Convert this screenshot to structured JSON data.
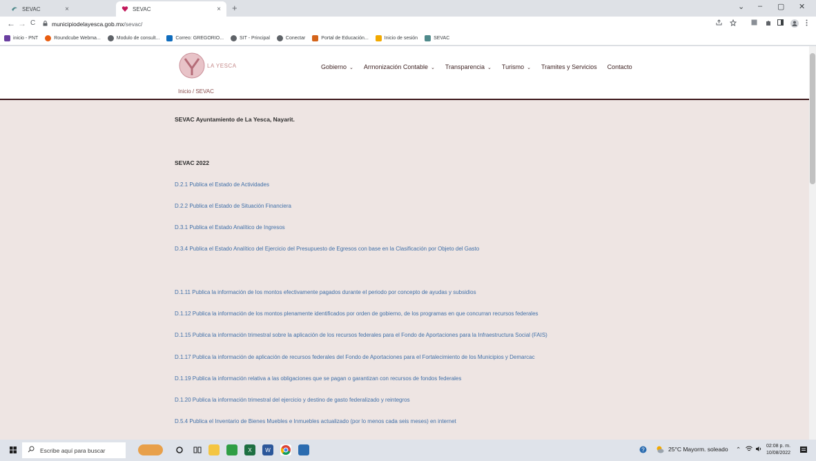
{
  "browser": {
    "tabs": [
      {
        "title": "SEVAC"
      },
      {
        "title": "SEVAC"
      }
    ],
    "new_tab": "+",
    "close_glyph": "×",
    "window_controls": {
      "collapse": "⌄",
      "minimize": "–",
      "restore": "▢",
      "close": "✕"
    },
    "nav": {
      "back": "←",
      "forward": "→",
      "reload": "C"
    },
    "url_host": "municipiodelayesca.gob.mx",
    "url_path": "/sevac/",
    "bookmarks": [
      {
        "label": "inicio - PNT",
        "color": "#6a3fa0"
      },
      {
        "label": "Roundcube Webma...",
        "color": "#e85d10"
      },
      {
        "label": "Modulo de consult...",
        "color": "#5f6368"
      },
      {
        "label": "Correo: GREGORIO...",
        "color": "#0f6cbd"
      },
      {
        "label": "SIT - Principal",
        "color": "#5f6368"
      },
      {
        "label": "Conectar",
        "color": "#5f6368"
      },
      {
        "label": "Portal de Educación...",
        "color": "#d4641a"
      },
      {
        "label": "Inicio de sesión",
        "color": "#f2a900"
      },
      {
        "label": "SEVAC",
        "color": "#4f8a8b"
      }
    ]
  },
  "site": {
    "logo_text": "LA YESCA",
    "nav": [
      {
        "label": "Gobierno",
        "dropdown": true
      },
      {
        "label": "Armonización Contable",
        "dropdown": true
      },
      {
        "label": "Transparencia",
        "dropdown": true
      },
      {
        "label": "Turismo",
        "dropdown": true
      },
      {
        "label": "Tramites y Servicios",
        "dropdown": false
      },
      {
        "label": "Contacto",
        "dropdown": false
      }
    ],
    "breadcrumb": "Inicio / SEVAC"
  },
  "content": {
    "heading": "SEVAC Ayuntamiento de La Yesca, Nayarit.",
    "year_heading": "SEVAC 2022",
    "links": [
      "D.2.1 Publica el Estado de Actividades",
      "D.2.2 Publica el Estado de Situación Financiera",
      "D.3.1 Publica el Estado Analítico de Ingresos",
      "D.3.4 Publica el Estado Analítico del Ejercicio del Presupuesto de Egresos con base en la Clasificación por Objeto del Gasto",
      "D.1.11 Publica la información de los montos efectivamente pagados durante el periodo por concepto de ayudas y subsidios",
      "D.1.12 Publica la información de los montos plenamente identificados por orden de gobierno, de los programas en que concurran recursos federales",
      "D.1.15 Publica la información trimestral sobre la aplicación de los recursos federales para el Fondo de Aportaciones para la Infraestructura Social (FAIS)",
      "D.1.17 Publica la información de aplicación de recursos federales del Fondo de Aportaciones para el Fortalecimiento de los Municipios y Demarcac",
      "D.1.19 Publica la información relativa a las obligaciones que se pagan o garantizan con recursos de fondos federales",
      "D.1.20 Publica la información trimestral del ejercicio y destino de gasto federalizado y reintegros",
      "D.5.4 Publica el Inventario de Bienes Muebles e Inmuebles actualizado (por lo menos cada seis meses) en internet"
    ]
  },
  "taskbar": {
    "search_placeholder": "Escribe aquí para buscar",
    "weather": "25°C  Mayorm. soleado",
    "time": "02:08 p. m.",
    "date": "10/08/2022",
    "notification_count": "3"
  }
}
